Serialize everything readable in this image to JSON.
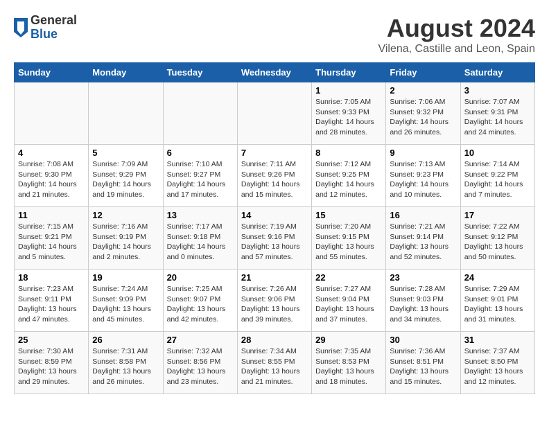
{
  "header": {
    "logo_general": "General",
    "logo_blue": "Blue",
    "month_title": "August 2024",
    "location": "Vilena, Castille and Leon, Spain"
  },
  "calendar": {
    "days_of_week": [
      "Sunday",
      "Monday",
      "Tuesday",
      "Wednesday",
      "Thursday",
      "Friday",
      "Saturday"
    ],
    "weeks": [
      [
        {
          "day": "",
          "info": ""
        },
        {
          "day": "",
          "info": ""
        },
        {
          "day": "",
          "info": ""
        },
        {
          "day": "",
          "info": ""
        },
        {
          "day": "1",
          "sunrise": "7:05 AM",
          "sunset": "9:33 PM",
          "daylight": "14 hours and 28 minutes."
        },
        {
          "day": "2",
          "sunrise": "7:06 AM",
          "sunset": "9:32 PM",
          "daylight": "14 hours and 26 minutes."
        },
        {
          "day": "3",
          "sunrise": "7:07 AM",
          "sunset": "9:31 PM",
          "daylight": "14 hours and 24 minutes."
        }
      ],
      [
        {
          "day": "4",
          "sunrise": "7:08 AM",
          "sunset": "9:30 PM",
          "daylight": "14 hours and 21 minutes."
        },
        {
          "day": "5",
          "sunrise": "7:09 AM",
          "sunset": "9:29 PM",
          "daylight": "14 hours and 19 minutes."
        },
        {
          "day": "6",
          "sunrise": "7:10 AM",
          "sunset": "9:27 PM",
          "daylight": "14 hours and 17 minutes."
        },
        {
          "day": "7",
          "sunrise": "7:11 AM",
          "sunset": "9:26 PM",
          "daylight": "14 hours and 15 minutes."
        },
        {
          "day": "8",
          "sunrise": "7:12 AM",
          "sunset": "9:25 PM",
          "daylight": "14 hours and 12 minutes."
        },
        {
          "day": "9",
          "sunrise": "7:13 AM",
          "sunset": "9:23 PM",
          "daylight": "14 hours and 10 minutes."
        },
        {
          "day": "10",
          "sunrise": "7:14 AM",
          "sunset": "9:22 PM",
          "daylight": "14 hours and 7 minutes."
        }
      ],
      [
        {
          "day": "11",
          "sunrise": "7:15 AM",
          "sunset": "9:21 PM",
          "daylight": "14 hours and 5 minutes."
        },
        {
          "day": "12",
          "sunrise": "7:16 AM",
          "sunset": "9:19 PM",
          "daylight": "14 hours and 2 minutes."
        },
        {
          "day": "13",
          "sunrise": "7:17 AM",
          "sunset": "9:18 PM",
          "daylight": "14 hours and 0 minutes."
        },
        {
          "day": "14",
          "sunrise": "7:19 AM",
          "sunset": "9:16 PM",
          "daylight": "13 hours and 57 minutes."
        },
        {
          "day": "15",
          "sunrise": "7:20 AM",
          "sunset": "9:15 PM",
          "daylight": "13 hours and 55 minutes."
        },
        {
          "day": "16",
          "sunrise": "7:21 AM",
          "sunset": "9:14 PM",
          "daylight": "13 hours and 52 minutes."
        },
        {
          "day": "17",
          "sunrise": "7:22 AM",
          "sunset": "9:12 PM",
          "daylight": "13 hours and 50 minutes."
        }
      ],
      [
        {
          "day": "18",
          "sunrise": "7:23 AM",
          "sunset": "9:11 PM",
          "daylight": "13 hours and 47 minutes."
        },
        {
          "day": "19",
          "sunrise": "7:24 AM",
          "sunset": "9:09 PM",
          "daylight": "13 hours and 45 minutes."
        },
        {
          "day": "20",
          "sunrise": "7:25 AM",
          "sunset": "9:07 PM",
          "daylight": "13 hours and 42 minutes."
        },
        {
          "day": "21",
          "sunrise": "7:26 AM",
          "sunset": "9:06 PM",
          "daylight": "13 hours and 39 minutes."
        },
        {
          "day": "22",
          "sunrise": "7:27 AM",
          "sunset": "9:04 PM",
          "daylight": "13 hours and 37 minutes."
        },
        {
          "day": "23",
          "sunrise": "7:28 AM",
          "sunset": "9:03 PM",
          "daylight": "13 hours and 34 minutes."
        },
        {
          "day": "24",
          "sunrise": "7:29 AM",
          "sunset": "9:01 PM",
          "daylight": "13 hours and 31 minutes."
        }
      ],
      [
        {
          "day": "25",
          "sunrise": "7:30 AM",
          "sunset": "8:59 PM",
          "daylight": "13 hours and 29 minutes."
        },
        {
          "day": "26",
          "sunrise": "7:31 AM",
          "sunset": "8:58 PM",
          "daylight": "13 hours and 26 minutes."
        },
        {
          "day": "27",
          "sunrise": "7:32 AM",
          "sunset": "8:56 PM",
          "daylight": "13 hours and 23 minutes."
        },
        {
          "day": "28",
          "sunrise": "7:34 AM",
          "sunset": "8:55 PM",
          "daylight": "13 hours and 21 minutes."
        },
        {
          "day": "29",
          "sunrise": "7:35 AM",
          "sunset": "8:53 PM",
          "daylight": "13 hours and 18 minutes."
        },
        {
          "day": "30",
          "sunrise": "7:36 AM",
          "sunset": "8:51 PM",
          "daylight": "13 hours and 15 minutes."
        },
        {
          "day": "31",
          "sunrise": "7:37 AM",
          "sunset": "8:50 PM",
          "daylight": "13 hours and 12 minutes."
        }
      ]
    ]
  }
}
